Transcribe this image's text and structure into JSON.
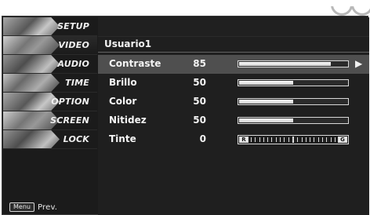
{
  "menu": {
    "items": [
      {
        "label": "SETUP",
        "icon": "setup-icon"
      },
      {
        "label": "VIDEO",
        "icon": "video-icon"
      },
      {
        "label": "AUDIO",
        "icon": "audio-icon"
      },
      {
        "label": "TIME",
        "icon": "time-icon"
      },
      {
        "label": "OPTION",
        "icon": "option-icon"
      },
      {
        "label": "SCREEN",
        "icon": "screen-icon"
      },
      {
        "label": "LOCK",
        "icon": "lock-icon"
      }
    ],
    "footer": {
      "pill": "Menu",
      "text": "Prev."
    }
  },
  "panel": {
    "title": "Usuario1",
    "rows": [
      {
        "label": "Contraste",
        "value": "85",
        "level": 0.85,
        "selected": true,
        "arrow": "▶"
      },
      {
        "label": "Brillo",
        "value": "50",
        "level": 0.5
      },
      {
        "label": "Color",
        "value": "50",
        "level": 0.5
      },
      {
        "label": "Nitidez",
        "value": "50",
        "level": 0.5
      },
      {
        "label": "Tinte",
        "value": "0",
        "tint": {
          "left": "R",
          "right": "G",
          "level": 0.5
        }
      }
    ]
  }
}
